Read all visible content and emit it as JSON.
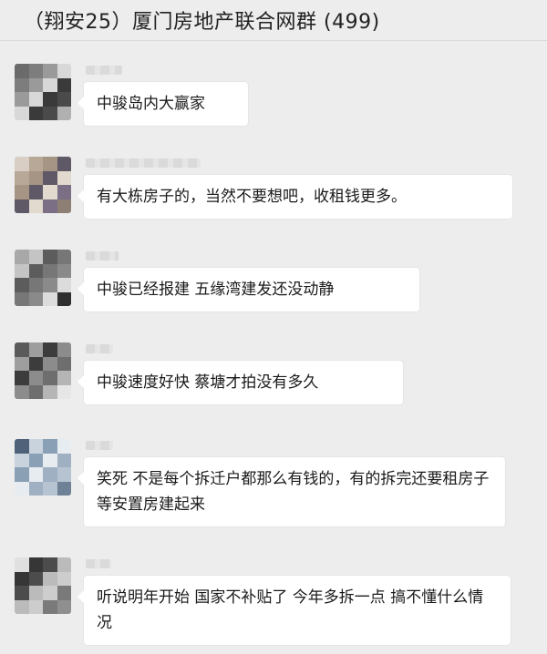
{
  "chat": {
    "title": "（翔安25）厦门房地产联合网群 (499)",
    "messages": [
      {
        "text": "中骏岛内大赢家"
      },
      {
        "text": "有大栋房子的，当然不要想吧，收租钱更多。"
      },
      {
        "text": "中骏已经报建 五缘湾建发还没动静"
      },
      {
        "text": "中骏速度好快 蔡塘才拍没有多久"
      },
      {
        "text": "笑死  不是每个拆迁户都那么有钱的，有的拆完还要租房子等安置房建起来"
      },
      {
        "text": "听说明年开始 国家不补贴了 今年多拆一点 搞不懂什么情况"
      }
    ]
  },
  "colors": {
    "background": "#ededed",
    "bubble": "#ffffff",
    "text": "#1a1a1a"
  }
}
